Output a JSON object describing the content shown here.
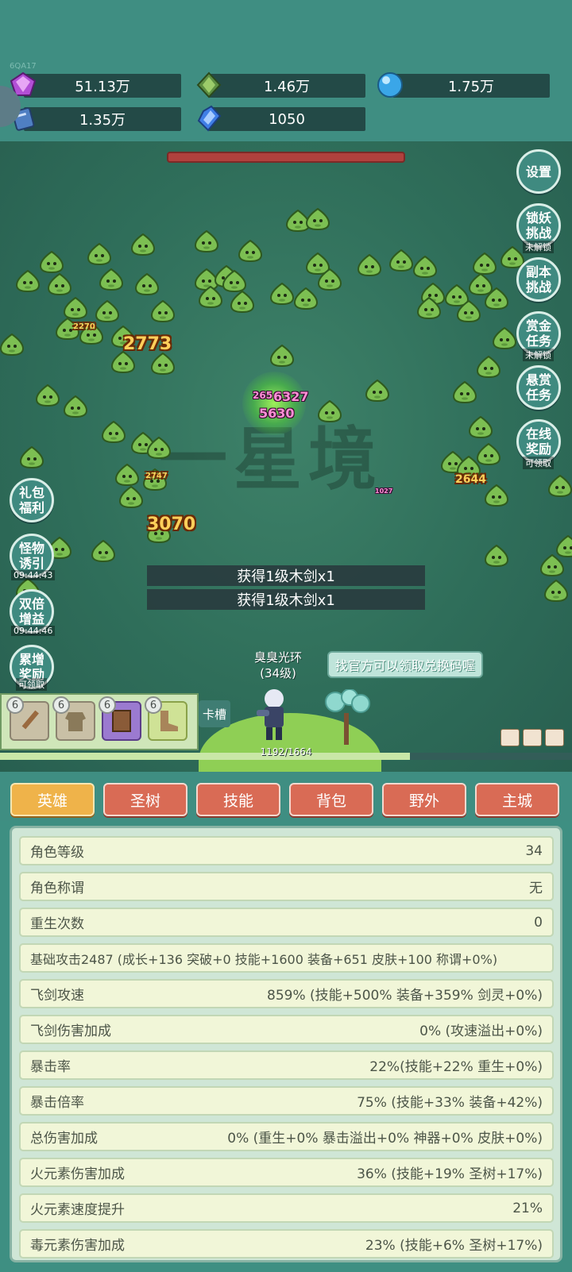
{
  "header": {
    "version": "6QA17",
    "resources": [
      {
        "icon": "purple-gem-icon",
        "value": "51.13万"
      },
      {
        "icon": "green-crystal-icon",
        "value": "1.46万"
      },
      {
        "icon": "blue-orb-icon",
        "value": "1.75万"
      },
      {
        "icon": "scroll-book-icon",
        "value": "1.35万"
      },
      {
        "icon": "blue-shard-icon",
        "value": "1050"
      }
    ]
  },
  "battle": {
    "watermark": "一星境",
    "damage_numbers": [
      "2773",
      "3070",
      "5630",
      "6327",
      "2644",
      "2747",
      "2270",
      "265",
      "1027"
    ],
    "notices": [
      "获得1级木剑x1",
      "获得1级木剑x1"
    ],
    "hero": {
      "aura": "臭臭光环",
      "level": "(34级)"
    },
    "bubble": "找官方可以领取兑换码喔",
    "card_slot_label": "卡槽",
    "slot_levels": [
      "6",
      "6",
      "6",
      "6"
    ],
    "exp_text": "1192/1664",
    "exp_fraction": 0.716
  },
  "right_buttons": [
    {
      "label": "设置",
      "sub": ""
    },
    {
      "label": "锁妖挑战",
      "sub": "未解锁"
    },
    {
      "label": "副本挑战",
      "sub": ""
    },
    {
      "label": "赏金任务",
      "sub": "未解锁"
    },
    {
      "label": "悬赏任务",
      "sub": ""
    },
    {
      "label": "在线奖励",
      "sub": "可领取"
    }
  ],
  "left_buttons": [
    {
      "label": "礼包福利",
      "sub": ""
    },
    {
      "label": "怪物诱引",
      "sub": "09:44:43"
    },
    {
      "label": "双倍增益",
      "sub": "09:44:46"
    },
    {
      "label": "累增奖励",
      "sub": "可领取"
    }
  ],
  "tabs": [
    "英雄",
    "圣树",
    "技能",
    "背包",
    "野外",
    "主城"
  ],
  "active_tab": "英雄",
  "stats": [
    {
      "label": "角色等级",
      "value": "34"
    },
    {
      "label": "角色称谓",
      "value": "无"
    },
    {
      "label": "重生次数",
      "value": "0"
    },
    {
      "label": "基础攻击2487 (成长+136 突破+0 技能+1600 装备+651 皮肤+100 称谓+0%)",
      "value": ""
    },
    {
      "label": "飞剑攻速",
      "value": "859% (技能+500% 装备+359% 剑灵+0%)"
    },
    {
      "label": "飞剑伤害加成",
      "value": "0% (攻速溢出+0%)"
    },
    {
      "label": "暴击率",
      "value": "22%(技能+22% 重生+0%)"
    },
    {
      "label": "暴击倍率",
      "value": "75% (技能+33% 装备+42%)"
    },
    {
      "label": "总伤害加成",
      "value": "0% (重生+0% 暴击溢出+0% 神器+0% 皮肤+0%)"
    },
    {
      "label": "火元素伤害加成",
      "value": "36% (技能+19% 圣树+17%)"
    },
    {
      "label": "火元素速度提升",
      "value": "21%"
    },
    {
      "label": "毒元素伤害加成",
      "value": "23% (技能+6% 圣树+17%)"
    }
  ],
  "colors": {
    "bg": "#3f8e82",
    "tab": "#d96b55",
    "tab_active": "#efb34a",
    "panel": "#cfe6d6",
    "row": "#f1f6d8"
  }
}
